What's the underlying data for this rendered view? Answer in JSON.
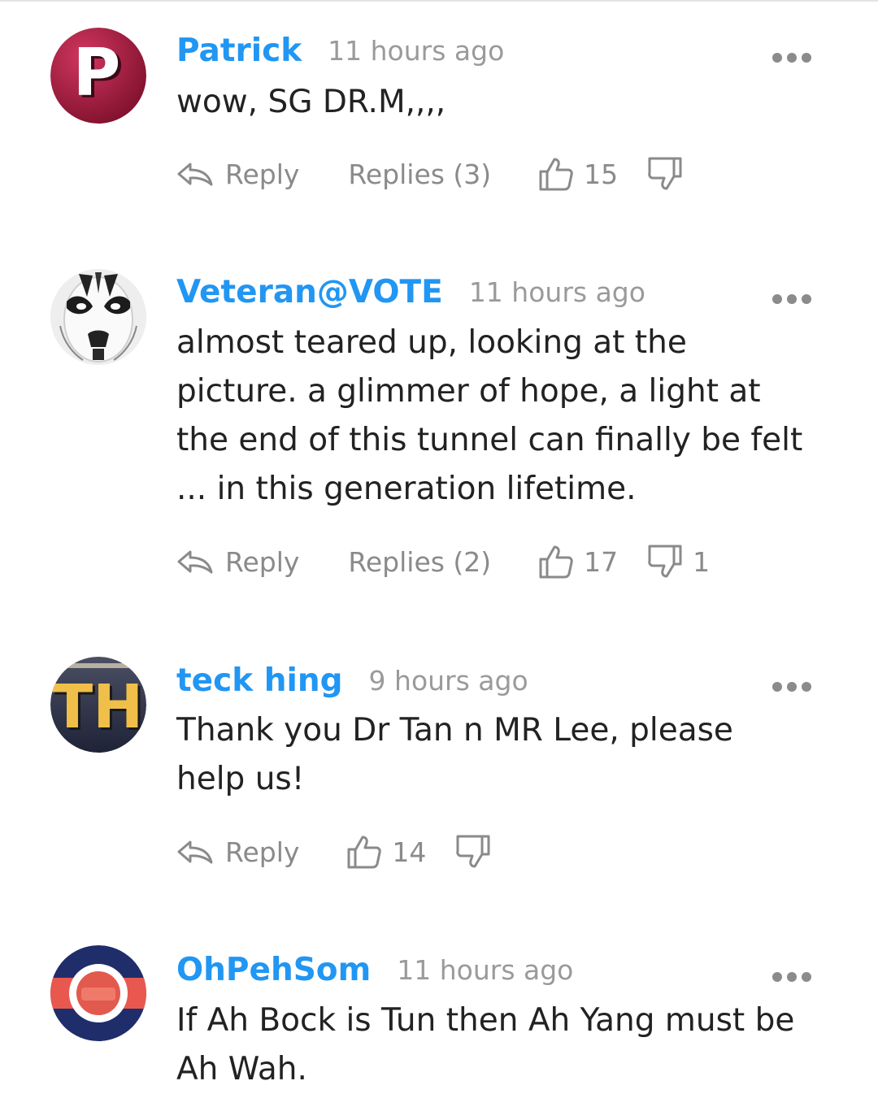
{
  "comments": [
    {
      "author": "Patrick",
      "time": "11 hours ago",
      "lines": [
        "wow, SG DR.M,,,,"
      ],
      "reply_label": "Reply",
      "replies_label": "Replies (3)",
      "likes": "15",
      "dislikes": "",
      "avatar_letter": "P",
      "avatar_color": "#9b1a3a"
    },
    {
      "author": "Veteran@VOTE",
      "time": "11 hours ago",
      "lines": [
        "almost teared up, looking at the",
        "picture. a glimmer of hope, a light at",
        "the end of this tunnel can finally be felt",
        "... in this generation lifetime."
      ],
      "reply_label": "Reply",
      "replies_label": "Replies (2)",
      "likes": "17",
      "dislikes": "1"
    },
    {
      "author": "teck hing",
      "time": "9 hours ago",
      "lines": [
        "Thank you Dr Tan n MR Lee, please",
        "help us!"
      ],
      "reply_label": "Reply",
      "likes": "14",
      "dislikes": "",
      "avatar_letter": "TH"
    },
    {
      "author": "OhPehSom",
      "time": "11 hours ago",
      "lines": [
        "If Ah Bock is Tun then Ah Yang must be",
        "Ah Wah."
      ]
    }
  ],
  "colors": {
    "author": "#2196f3",
    "muted": "#8a8a8a",
    "text": "#222222"
  },
  "icons": {
    "reply": "reply-arrow-icon",
    "like": "thumbs-up-icon",
    "dislike": "thumbs-down-icon",
    "more": "more-dots-icon"
  }
}
